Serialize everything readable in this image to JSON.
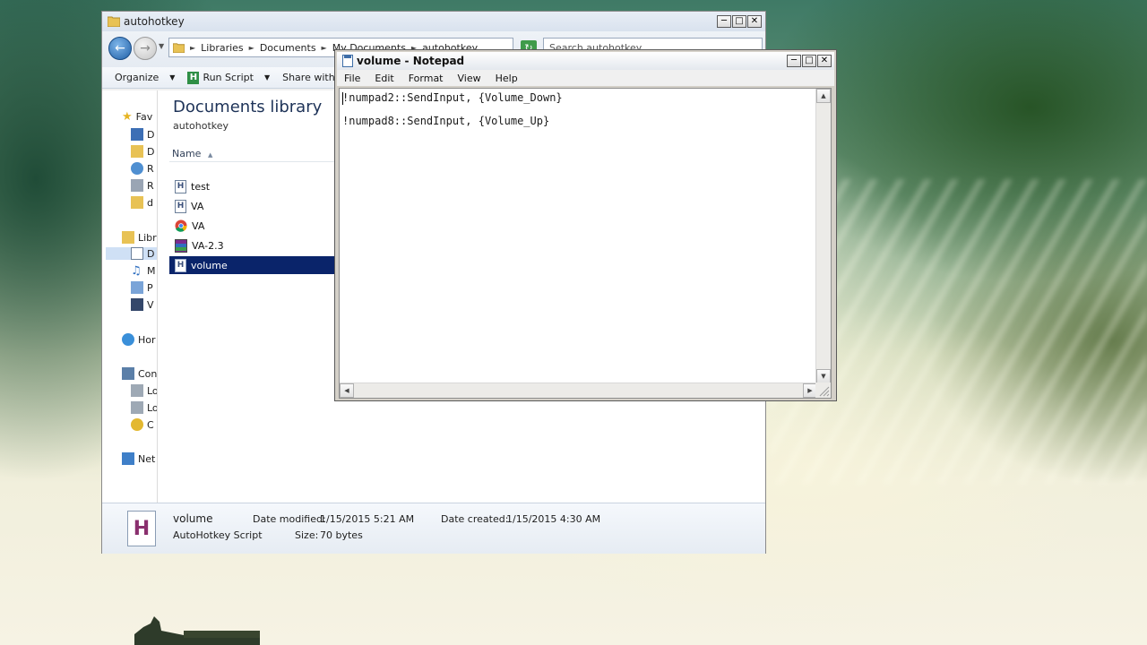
{
  "explorer": {
    "title": "autohotkey",
    "breadcrumb": [
      "Libraries",
      "Documents",
      "My Documents",
      "autohotkey"
    ],
    "search_placeholder": "Search autohotkey",
    "toolbar": {
      "organize": "Organize",
      "run_script": "Run Script",
      "share_with": "Share with"
    },
    "nav": {
      "favorites": "Fav",
      "fav_items": [
        "D",
        "D",
        "R",
        "R",
        "d"
      ],
      "libraries": "Libr",
      "lib_items": [
        "D",
        "M",
        "P",
        "V"
      ],
      "homegroup": "Hor",
      "computer": "Con",
      "comp_items": [
        "Lo",
        "Lo",
        "C"
      ],
      "network": "Net"
    },
    "library_title": "Documents library",
    "library_sub": "autohotkey",
    "column_name": "Name",
    "files": [
      {
        "name": "test",
        "icon": "ahk-script-icon"
      },
      {
        "name": "VA",
        "icon": "ahk-script-icon"
      },
      {
        "name": "VA",
        "icon": "chrome-icon"
      },
      {
        "name": "VA-2.3",
        "icon": "winrar-archive-icon"
      },
      {
        "name": "volume",
        "icon": "ahk-script-icon",
        "selected": true
      }
    ],
    "details": {
      "name": "volume",
      "type": "AutoHotkey Script",
      "modified_label": "Date modified:",
      "modified": "1/15/2015 5:21 AM",
      "created_label": "Date created:",
      "created": "1/15/2015 4:30 AM",
      "size_label": "Size:",
      "size": "70 bytes",
      "icon_letter": "H"
    }
  },
  "notepad": {
    "title": "volume - Notepad",
    "menu": [
      "File",
      "Edit",
      "Format",
      "View",
      "Help"
    ],
    "lines": [
      "!numpad2::SendInput, {Volume_Down}",
      "!numpad8::SendInput, {Volume_Up}"
    ]
  },
  "colors": {
    "selection": "#0a246a",
    "notepad_frame": "#d4d0c8",
    "title_text": "#1e3358"
  }
}
